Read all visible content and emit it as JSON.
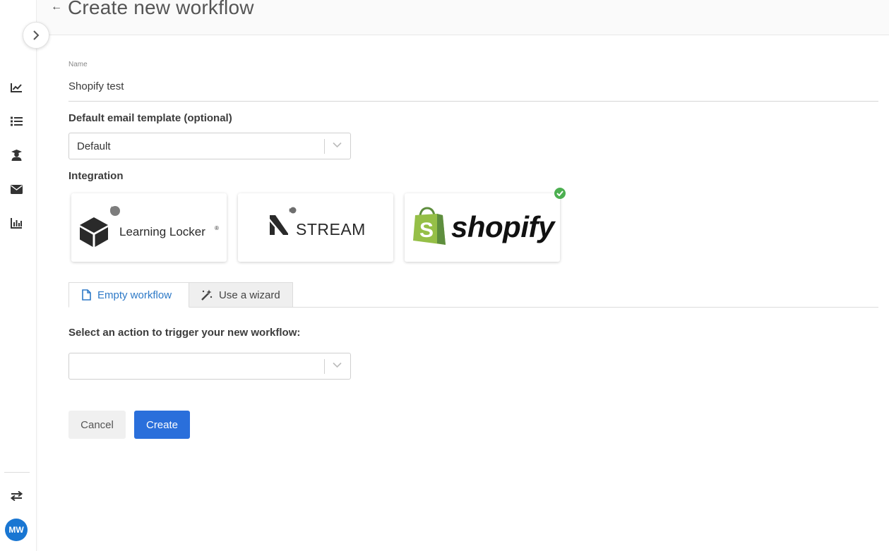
{
  "header": {
    "title": "Create new workflow"
  },
  "sidebar": {
    "items": [
      {
        "icon": "trend-chart-icon"
      },
      {
        "icon": "list-icon"
      },
      {
        "icon": "user-graduate-icon"
      },
      {
        "icon": "envelope-icon"
      },
      {
        "icon": "bar-chart-icon"
      }
    ],
    "bottom_icon": "swap-arrows-icon",
    "avatar": "MW"
  },
  "form": {
    "name_label": "Name",
    "name_value": "Shopify test",
    "email_template_label": "Default email template (optional)",
    "email_template_value": "Default",
    "integration_label": "Integration",
    "integrations": [
      {
        "name": "Learning Locker",
        "mark": "®",
        "selected": false
      },
      {
        "name": "STREAM",
        "selected": false
      },
      {
        "name": "shopify",
        "selected": true
      }
    ],
    "tabs": [
      {
        "label": "Empty workflow",
        "active": true
      },
      {
        "label": "Use a wizard",
        "active": false
      }
    ],
    "trigger_label": "Select an action to trigger your new workflow:",
    "trigger_value": "",
    "cancel_label": "Cancel",
    "create_label": "Create"
  },
  "colors": {
    "primary": "#2a6fdb",
    "tab_active": "#2d79c7",
    "success": "#4caf50",
    "avatar": "#1976d2",
    "shopify_green": "#95bf47"
  }
}
